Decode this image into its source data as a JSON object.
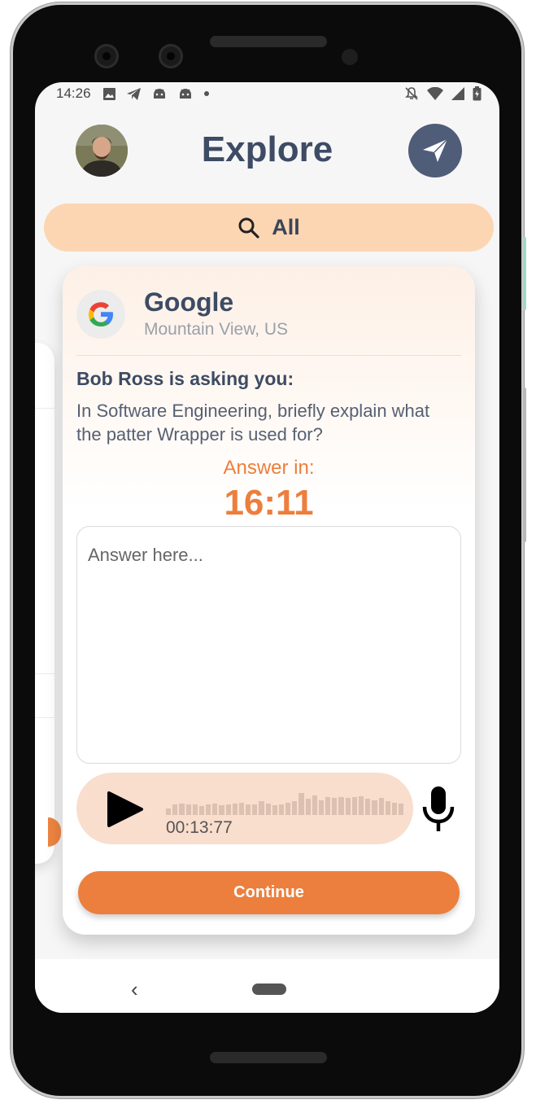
{
  "status_bar": {
    "time": "14:26"
  },
  "header": {
    "title": "Explore"
  },
  "filter": {
    "label": "All"
  },
  "card": {
    "company_name": "Google",
    "company_location": "Mountain View, US",
    "asker": "Bob Ross is asking you:",
    "question": "In Software Engineering, briefly explain what the patter Wrapper is used for?",
    "answer_in_label": "Answer in:",
    "timer": "16:11",
    "answer_placeholder": "Answer here...",
    "audio_time": "00:13:77",
    "continue_label": "Continue"
  },
  "colors": {
    "accent": "#ec7f3d",
    "title_text": "#3d4b64",
    "filter_bg": "#fcd6b3",
    "audio_bg": "#f9ddcd",
    "send_button_bg": "#4f5d79"
  }
}
